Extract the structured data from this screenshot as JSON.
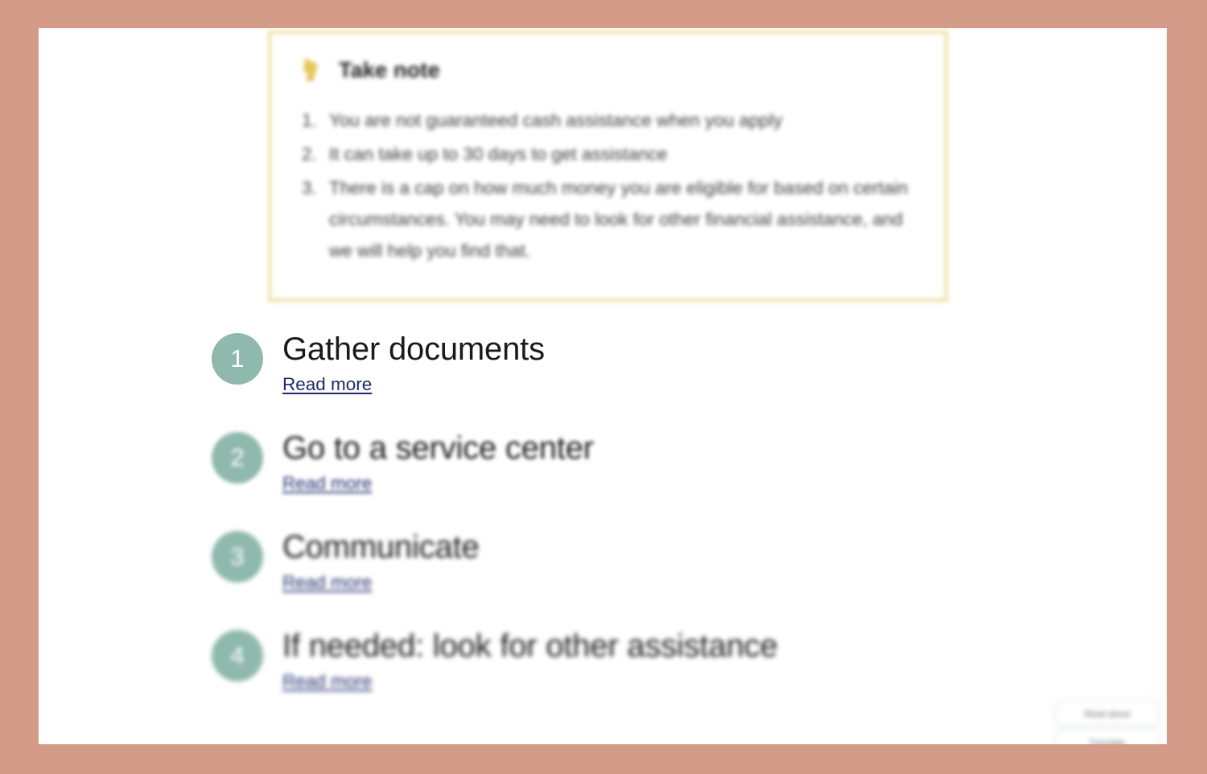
{
  "frame": {
    "border_color": "#d49c88",
    "page_background": "#ffffff"
  },
  "note": {
    "icon": "pencil-icon",
    "icon_color": "#e5c75a",
    "border_color": "#efdfa2",
    "title": "Take note",
    "items": [
      {
        "num": "1.",
        "text": "You are not guaranteed cash assistance when you apply"
      },
      {
        "num": "2.",
        "text": "It can take up to 30 days to get assistance"
      },
      {
        "num": "3.",
        "text": "There is a cap on how much money you are eligible for based on certain circumstances. You may need to look for other financial assistance, and we will help you find that."
      }
    ]
  },
  "steps": {
    "badge_color": "#8fb9ad",
    "link_color": "#1f2a6b",
    "items": [
      {
        "number": "1",
        "title": "Gather documents",
        "link": "Read more"
      },
      {
        "number": "2",
        "title": "Go to a service center",
        "link": "Read more"
      },
      {
        "number": "3",
        "title": "Communicate",
        "link": "Read more"
      },
      {
        "number": "4",
        "title": "If needed: look for other assistance",
        "link": "Read more"
      }
    ]
  },
  "float_widget": {
    "buttons": [
      {
        "label": "Read aloud"
      },
      {
        "label": "Translate"
      }
    ]
  }
}
